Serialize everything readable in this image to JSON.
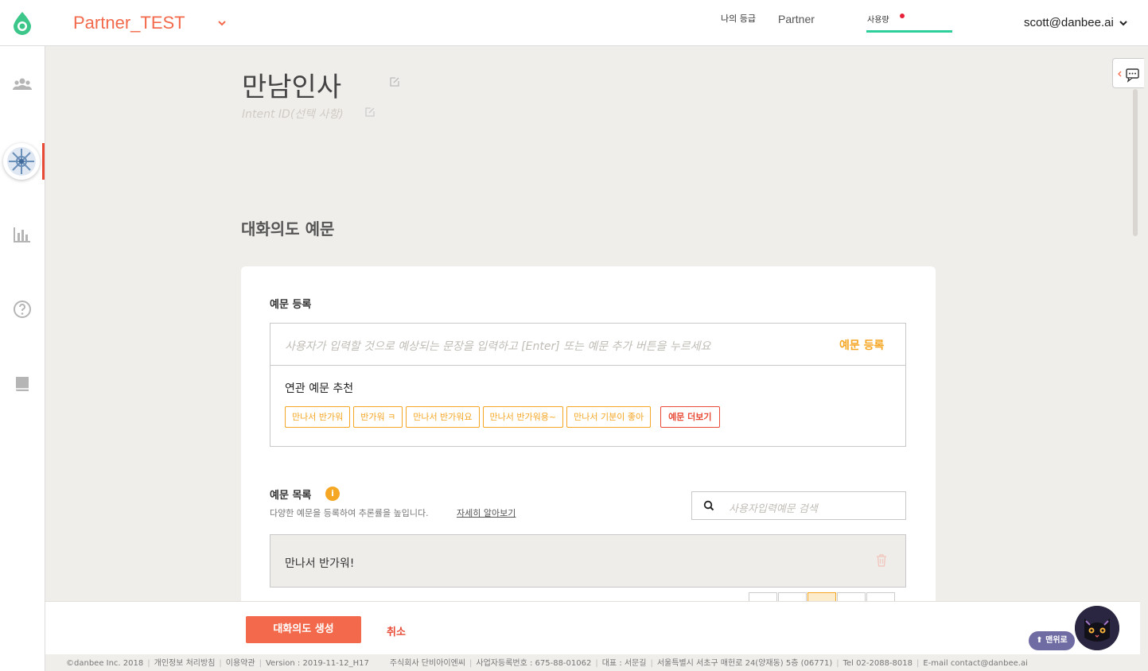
{
  "header": {
    "project_name": "Partner_TEST",
    "nav_grade": "나의 등급",
    "nav_partner": "Partner",
    "nav_usage": "사용량",
    "user_email": "scott@danbee.ai",
    "colors": {
      "brand": "#f26a4b",
      "usage_bar": "#2fcf9b",
      "alert_dot": "#e8203a"
    }
  },
  "sidebar": {
    "items": [
      {
        "icon": "users-icon"
      },
      {
        "icon": "bot-avatar-icon",
        "active": true
      },
      {
        "icon": "chart-icon"
      },
      {
        "icon": "help-icon"
      },
      {
        "icon": "book-icon"
      }
    ]
  },
  "intent": {
    "title": "만남인사",
    "id_placeholder": "Intent ID(선택 사항)"
  },
  "examples_section": {
    "title": "대화의도 예문",
    "register_label": "예문 등록",
    "input_placeholder": "사용자가 입력할 것으로 예상되는 문장을 입력하고 [Enter] 또는 예문 추가 버튼을 누르세요",
    "register_button": "예문 등록",
    "related_title": "연관 예문 추천",
    "related_chips": [
      "만나서 반가워",
      "반가워 ㅋ",
      "만나서 반가워요",
      "만나서 반가워용~",
      "만나서 기분이 좋아"
    ],
    "more_button": "예문 더보기",
    "list_label": "예문 목록",
    "info_badge": "i",
    "list_desc": "다양한 예문을 등록하여 추론률을 높입니다.",
    "learn_more": "자세히 알아보기",
    "search_placeholder": "사용자입력예문 검색",
    "examples": [
      "만나서 반가워!"
    ],
    "colors": {
      "accent": "#f5a623",
      "more": "#e84a35"
    }
  },
  "actions": {
    "create_button": "대화의도 생성",
    "cancel_button": "취소"
  },
  "footer": {
    "items": [
      "©danbee Inc. 2018",
      "개인정보 처리방침",
      "이용약관",
      "Version : 2019-11-12_H17",
      "주식회사 단비아이엔씨",
      "사업자등록번호 : 675-88-01062",
      "대표 : 서문길",
      "서울특별시 서초구 매헌로 24(양재동) 5층 (06771)",
      "Tel 02-2088-8018",
      "E-mail contact@danbee.ai"
    ]
  },
  "floating": {
    "menu_top": "⬆ 맨위로"
  }
}
